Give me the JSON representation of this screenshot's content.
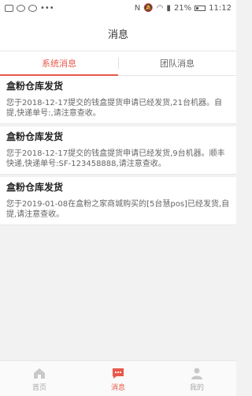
{
  "status_bar": {
    "battery": "21%",
    "time": "11:12"
  },
  "header": {
    "title": "消息"
  },
  "tabs": [
    {
      "label": "系统消息",
      "active": true
    },
    {
      "label": "团队消息",
      "active": false
    }
  ],
  "messages": [
    {
      "title": "盒粉仓库发货",
      "body": "您于2018-12-17提交的钱盒提货申请已经发货,21台机器。自提,快递单号:,请注意查收。"
    },
    {
      "title": "盒粉仓库发货",
      "body": "您于2018-12-17提交的钱盒提货申请已经发货,9台机器。顺丰快递,快递单号:SF-123458888,请注意查收。"
    },
    {
      "title": "盒粉仓库发货",
      "body": "您于2019-01-08在盒粉之家商城购买的[5台慧pos]已经发货,自提,请注意查收。"
    }
  ],
  "tabbar": [
    {
      "label": "首页",
      "icon": "home-icon",
      "active": false
    },
    {
      "label": "消息",
      "icon": "message-icon",
      "active": true
    },
    {
      "label": "我的",
      "icon": "profile-icon",
      "active": false
    }
  ],
  "colors": {
    "accent": "#e8584a",
    "background": "#f2f2f2"
  }
}
